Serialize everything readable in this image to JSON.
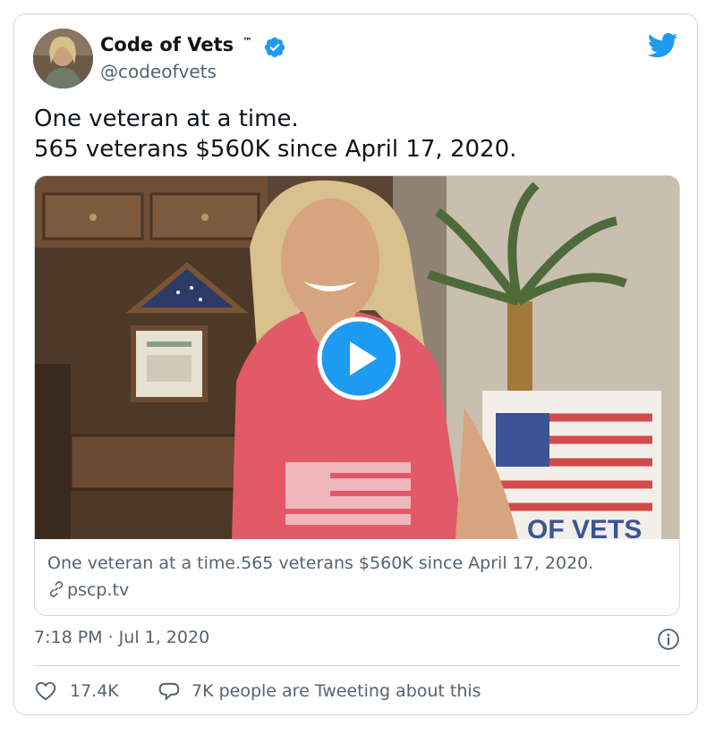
{
  "author": {
    "name": "Code of Vets",
    "trademark": "™",
    "handle": "@codeofvets",
    "verified": true
  },
  "tweet": {
    "line1": "One veteran at a time.",
    "line2": "565 veterans $560K since April 17, 2020."
  },
  "media_card": {
    "title": "One veteran at a time.565 veterans $560K since April 17, 2020.",
    "domain": "pscp.tv"
  },
  "meta": {
    "timestamp": "7:18 PM · Jul 1, 2020"
  },
  "actions": {
    "likes": "17.4K",
    "conversation": "7K people are Tweeting about this"
  },
  "colors": {
    "brand_blue": "#1d9bf0",
    "secondary_text": "#536471",
    "border": "#cfd9de",
    "shirt": "#e25a68"
  },
  "icons": [
    "twitter-bird-icon",
    "verified-badge-icon",
    "play-icon",
    "link-icon",
    "info-icon",
    "heart-icon",
    "reply-bubble-icon"
  ]
}
